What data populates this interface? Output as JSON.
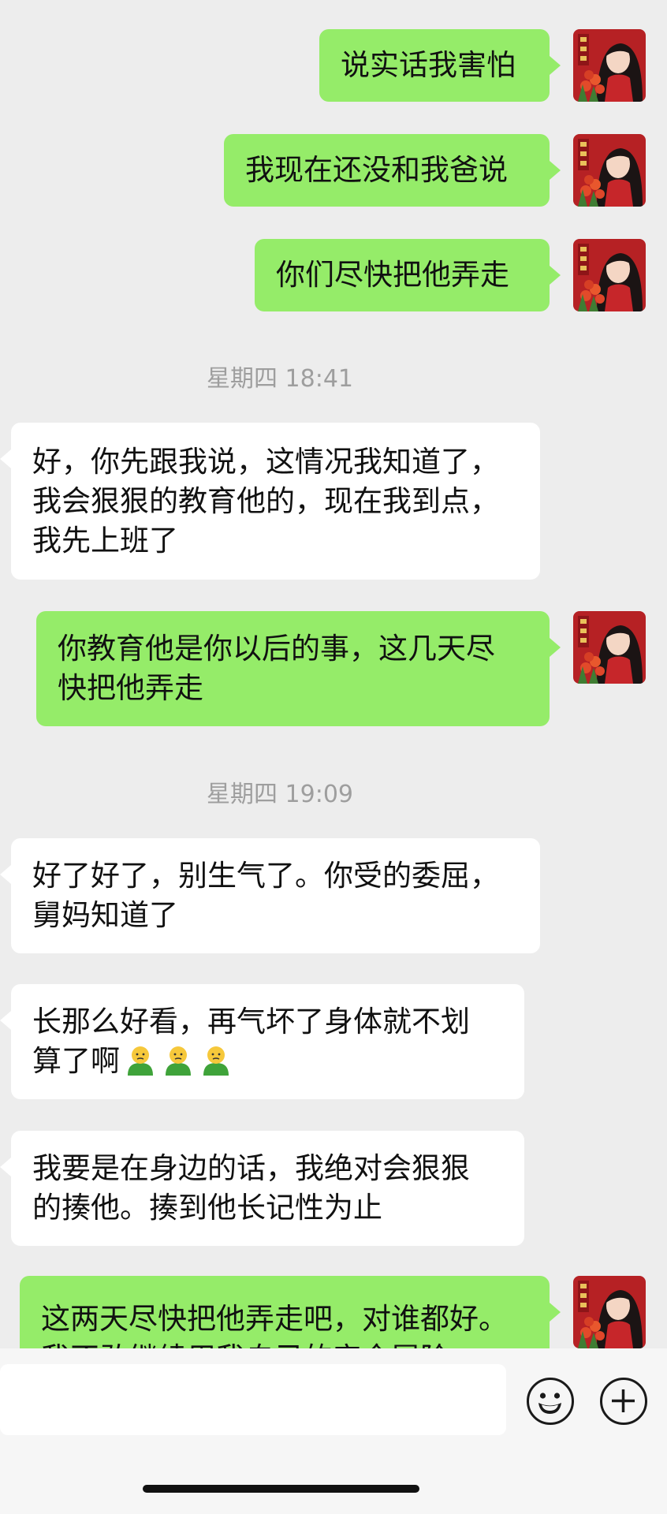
{
  "conversation": {
    "messages": [
      {
        "direction": "out",
        "lines": [
          "说实话我害怕"
        ]
      },
      {
        "direction": "out",
        "lines": [
          "我现在还没和我爸说"
        ]
      },
      {
        "direction": "out",
        "lines": [
          "你们尽快把他弄走"
        ]
      },
      {
        "direction": "time",
        "text": "星期四 18:41"
      },
      {
        "direction": "in",
        "lines": [
          "好，你先跟我说，这情况我知道了，",
          "我会狠狠的教育他的，现在我到点，",
          "我先上班了"
        ]
      },
      {
        "direction": "out",
        "lines": [
          "你教育他是你以后的事，这几天尽",
          "快把他弄走"
        ]
      },
      {
        "direction": "time",
        "text": "星期四 19:09"
      },
      {
        "direction": "in",
        "lines": [
          "好了好了，别生气了。你受的委屈，",
          "舅妈知道了"
        ]
      },
      {
        "direction": "in",
        "lines": [
          "长那么好看，再气坏了身体就不划",
          "算了啊"
        ]
      },
      {
        "direction": "in",
        "lines": [
          "我要是在身边的话，我绝对会狠狠",
          "的揍他。揍到他长记性为止"
        ]
      },
      {
        "direction": "out",
        "lines": [
          "这两天尽快把他弄走吧，对谁都好。",
          "我不敢继续用我自己的安全冒险"
        ]
      }
    ]
  },
  "emoji": {
    "name": "frowning-person-emoji",
    "count": 3
  },
  "composer": {
    "input_value": "",
    "emoji_icon": "smiley-face-icon",
    "plus_icon": "plus-icon"
  },
  "colors": {
    "outgoing_bubble": "#95ec69",
    "incoming_bubble": "#ffffff",
    "background": "#ededed",
    "timestamp": "#9e9e9e"
  }
}
